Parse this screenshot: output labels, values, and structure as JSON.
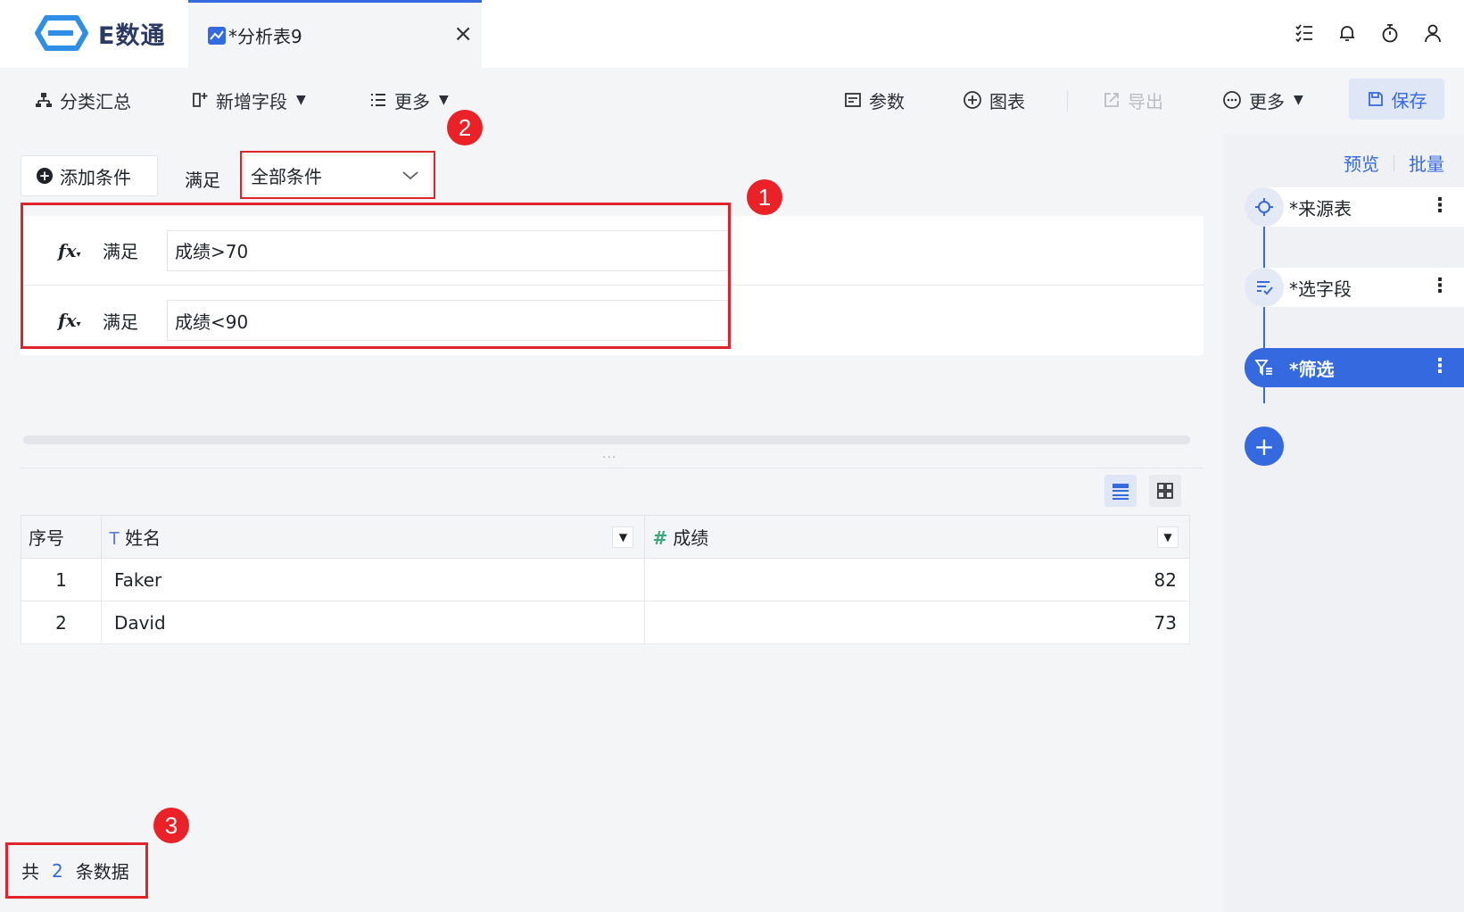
{
  "app": {
    "logo_text": "E数通",
    "tab_label": "*分析表9",
    "tab_close": "×"
  },
  "top_icons": [
    "list-check-icon",
    "bell-icon",
    "stopwatch-icon",
    "user-icon"
  ],
  "toolbar": {
    "summary_label": "分类汇总",
    "new_field_label": "新增字段",
    "more_left_label": "更多",
    "params_label": "参数",
    "chart_label": "图表",
    "export_label": "导出",
    "more_right_label": "更多",
    "save_label": "保存"
  },
  "filter": {
    "add_condition_label": "添加条件",
    "satisfy_label": "满足",
    "mode_value": "全部条件",
    "conditions": [
      {
        "fx": "fx",
        "label": "满足",
        "expression": "成绩>70"
      },
      {
        "fx": "fx",
        "label": "满足",
        "expression": "成绩<90"
      }
    ]
  },
  "badges": [
    "1",
    "2",
    "3"
  ],
  "split_handle": "···",
  "table": {
    "columns": [
      {
        "label": "序号"
      },
      {
        "type_icon": "T",
        "label": "姓名"
      },
      {
        "type_icon": "#",
        "label": "成绩"
      }
    ],
    "rows": [
      {
        "index": "1",
        "name": "Faker",
        "score": "82"
      },
      {
        "index": "2",
        "name": "David",
        "score": "73"
      }
    ]
  },
  "footer": {
    "prefix": "共",
    "count": "2",
    "suffix": "条数据"
  },
  "right_panel": {
    "preview_label": "预览",
    "batch_label": "批量",
    "steps": [
      {
        "label": "*来源表",
        "icon": "crosshair-icon"
      },
      {
        "label": "*选字段",
        "icon": "select-fields-icon"
      },
      {
        "label": "*筛选",
        "icon": "filter-icon"
      }
    ],
    "add_step_label": "+"
  },
  "colors": {
    "accent": "#3569e0",
    "highlight": "#e0242c",
    "badge": "#ea2227"
  }
}
